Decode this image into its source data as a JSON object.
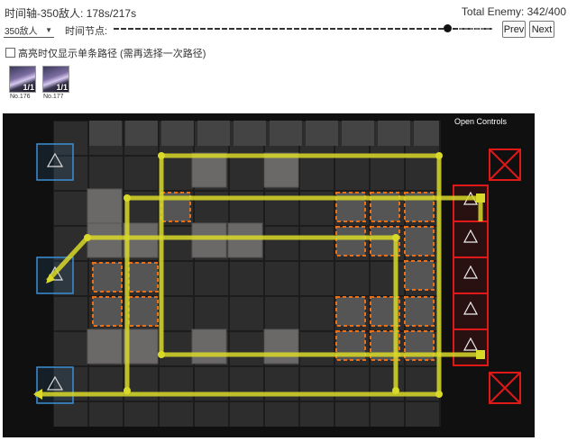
{
  "header": {
    "timeline_title": "时间轴-350敌人: 178s/217s",
    "total_enemy": "Total Enemy: 342/400"
  },
  "controls": {
    "wave_select_value": "350敌人",
    "node_label": "时间节点:",
    "slider_position": 0.88,
    "prev_label": "Prev",
    "next_label": "Next",
    "highlight_checked": false,
    "highlight_label": "高亮时仅显示单条路径 (需再选择一次路径)"
  },
  "enemies": [
    {
      "count": "1/1",
      "number": "No.176"
    },
    {
      "count": "1/1",
      "number": "No.177"
    }
  ],
  "map": {
    "open_controls_label": "Open Controls",
    "colors": {
      "route": "#d9d92a",
      "spawn_blue": "#3a8fd6",
      "goal_red": "#e01818",
      "hazard_orange": "#e8701a",
      "floor_dark": "#2b2b2b",
      "block_grey": "#6a6767"
    }
  }
}
